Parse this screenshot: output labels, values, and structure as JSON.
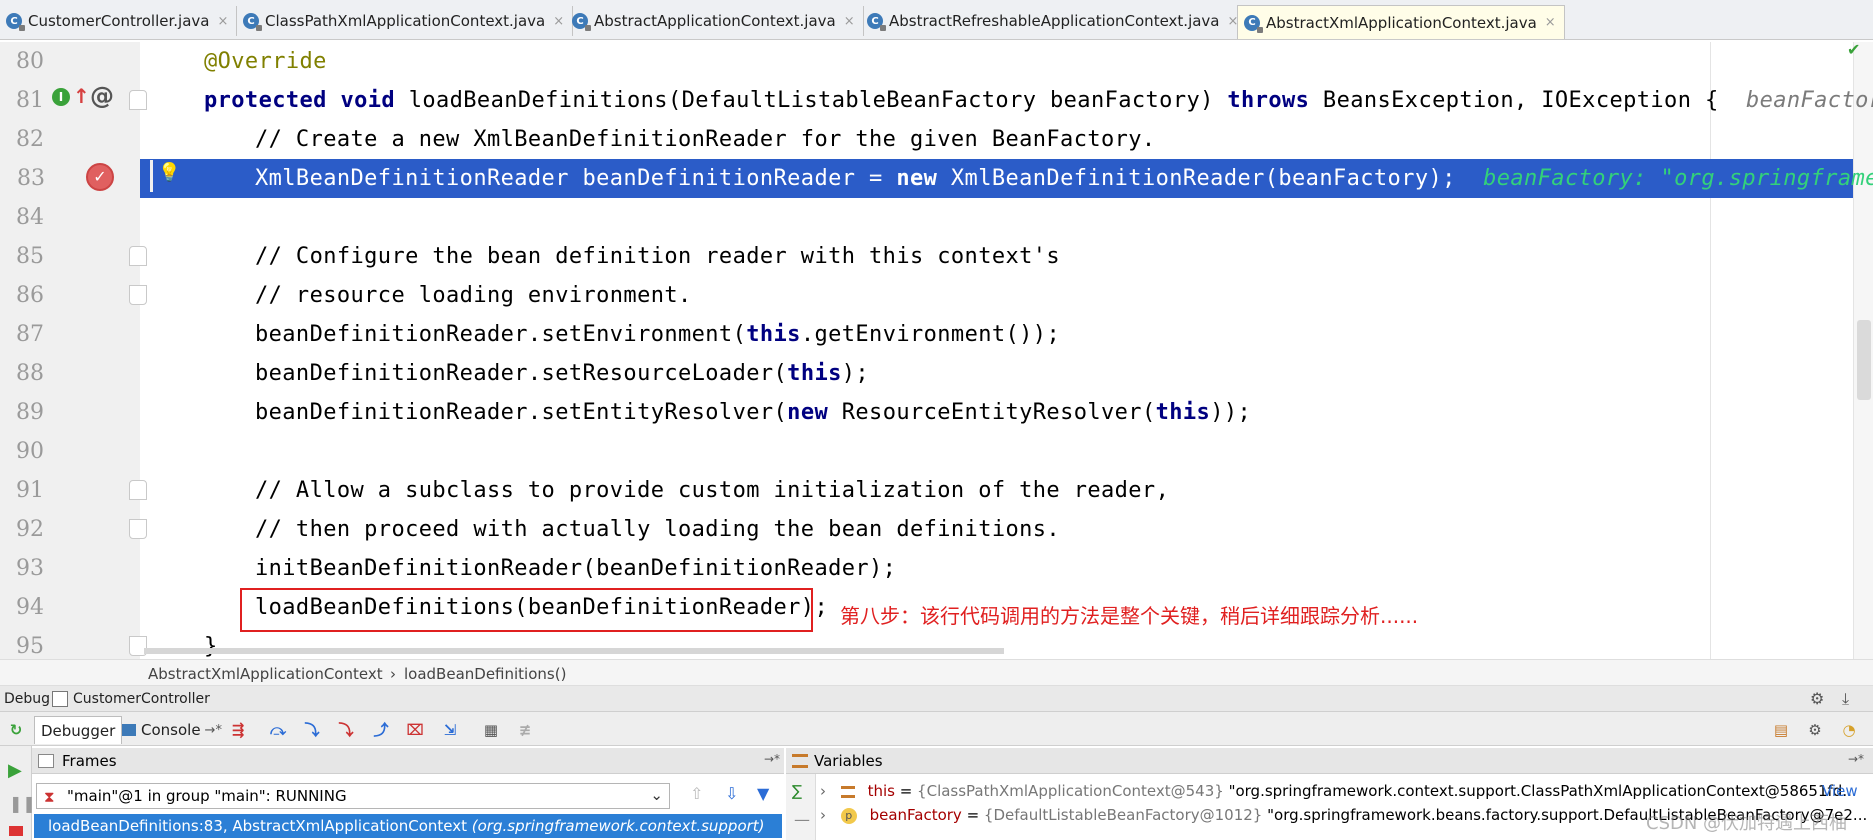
{
  "tabs": [
    {
      "label": "CustomerController.java",
      "close": "×"
    },
    {
      "label": "ClassPathXmlApplicationContext.java",
      "close": "×"
    },
    {
      "label": "AbstractApplicationContext.java",
      "close": "×"
    },
    {
      "label": "AbstractRefreshableApplicationContext.java",
      "close": "×"
    },
    {
      "label": "AbstractXmlApplicationContext.java",
      "close": "×"
    }
  ],
  "tab_icon_letter": "C",
  "editor": {
    "gutter_icons": {
      "implements": "I",
      "at": "@"
    },
    "line_numbers": [
      "80",
      "81",
      "82",
      "83",
      "84",
      "85",
      "86",
      "87",
      "88",
      "89",
      "90",
      "91",
      "92",
      "93",
      "94",
      "95"
    ],
    "lines": {
      "l80": "@Override",
      "l81_a": "protected void",
      "l81_b": " loadBeanDefinitions(DefaultListableBeanFactory beanFactory) ",
      "l81_c": "throws",
      "l81_d": " BeansException, IOException {",
      "l81_hint": "beanFactory: ",
      "l82": "// Create a new XmlBeanDefinitionReader for the given BeanFactory.",
      "l83_a": "XmlBeanDefinitionReader beanDefinitionReader = ",
      "l83_b": "new",
      "l83_c": " XmlBeanDefinitionReader(beanFactory);",
      "l83_hint": "beanFactory: \"org.springframework.",
      "l85": "// Configure the bean definition reader with this context's",
      "l86": "// resource loading environment.",
      "l87_a": "beanDefinitionReader.setEnvironment(",
      "l87_b": "this",
      "l87_c": ".getEnvironment());",
      "l88_a": "beanDefinitionReader.setResourceLoader(",
      "l88_b": "this",
      "l88_c": ");",
      "l89_a": "beanDefinitionReader.setEntityResolver(",
      "l89_b": "new",
      "l89_c": " ResourceEntityResolver(",
      "l89_d": "this",
      "l89_e": "));",
      "l91": "// Allow a subclass to provide custom initialization of the reader,",
      "l92": "// then proceed with actually loading the bean definitions.",
      "l93": "initBeanDefinitionReader(beanDefinitionReader);",
      "l94": "loadBeanDefinitions(beanDefinitionReader);",
      "l95": "}"
    },
    "annotation": "第八步：该行代码调用的方法是整个关键，稍后详细跟踪分析......",
    "current_line": "83"
  },
  "breadcrumb": {
    "class": "AbstractXmlApplicationContext",
    "separator": "›",
    "method": "loadBeanDefinitions()"
  },
  "debug": {
    "title": "Debug",
    "config": "CustomerController",
    "tabs": {
      "debugger": "Debugger",
      "console": "Console"
    },
    "frames_title": "Frames",
    "thread": "\"main\"@1 in group \"main\": RUNNING",
    "frame_method": "loadBeanDefinitions:83, AbstractXmlApplicationContext",
    "frame_pkg": "(org.springframework.context.support)",
    "variables_title": "Variables",
    "variables": [
      {
        "name": "this",
        "eq": " = ",
        "type": "{ClassPathXmlApplicationContext@543}",
        "value": " \"org.springframework.context.support.ClassPathXmlApplicationContext@58651fd..."
      },
      {
        "name": "beanFactory",
        "eq": " = ",
        "type": "{DefaultListableBeanFactory@1012}",
        "value": " \"org.springframework.beans.factory.support.DefaultListableBeanFactory@7e2..."
      }
    ],
    "view_link": "View"
  },
  "watermark": "CSDN @伏加特遇上西柚",
  "colors": {
    "accent": "#2b5cc8",
    "annotation": "#e02020",
    "selection": "#2b7fd6"
  }
}
